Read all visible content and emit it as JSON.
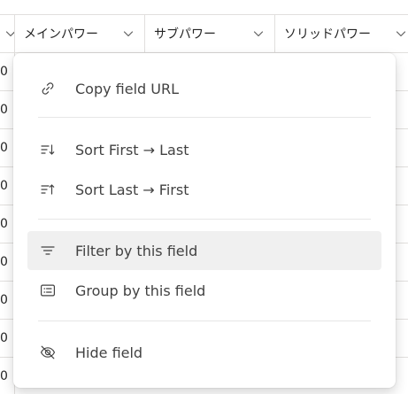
{
  "grid": {
    "columns": [
      {
        "label": ""
      },
      {
        "label": "メインパワー"
      },
      {
        "label": "サブパワー"
      },
      {
        "label": "ソリッドパワー"
      }
    ],
    "row_cells": [
      "0",
      "0",
      "0",
      "0",
      "0",
      "0",
      "0",
      "0",
      "0"
    ]
  },
  "menu": {
    "copy_url": {
      "label": "Copy field URL",
      "icon": "link-icon"
    },
    "sort_first_last": {
      "label": "Sort First → Last",
      "icon": "sort-ascending-icon"
    },
    "sort_last_first": {
      "label": "Sort Last → First",
      "icon": "sort-descending-icon"
    },
    "filter": {
      "label": "Filter by this field",
      "icon": "filter-icon",
      "highlighted": true
    },
    "group": {
      "label": "Group by this field",
      "icon": "group-list-icon"
    },
    "hide": {
      "label": "Hide field",
      "icon": "eye-off-icon"
    }
  },
  "colors": {
    "text": "#424242",
    "hover_bg": "#f0f0f0",
    "divider": "#e1dfdd"
  }
}
